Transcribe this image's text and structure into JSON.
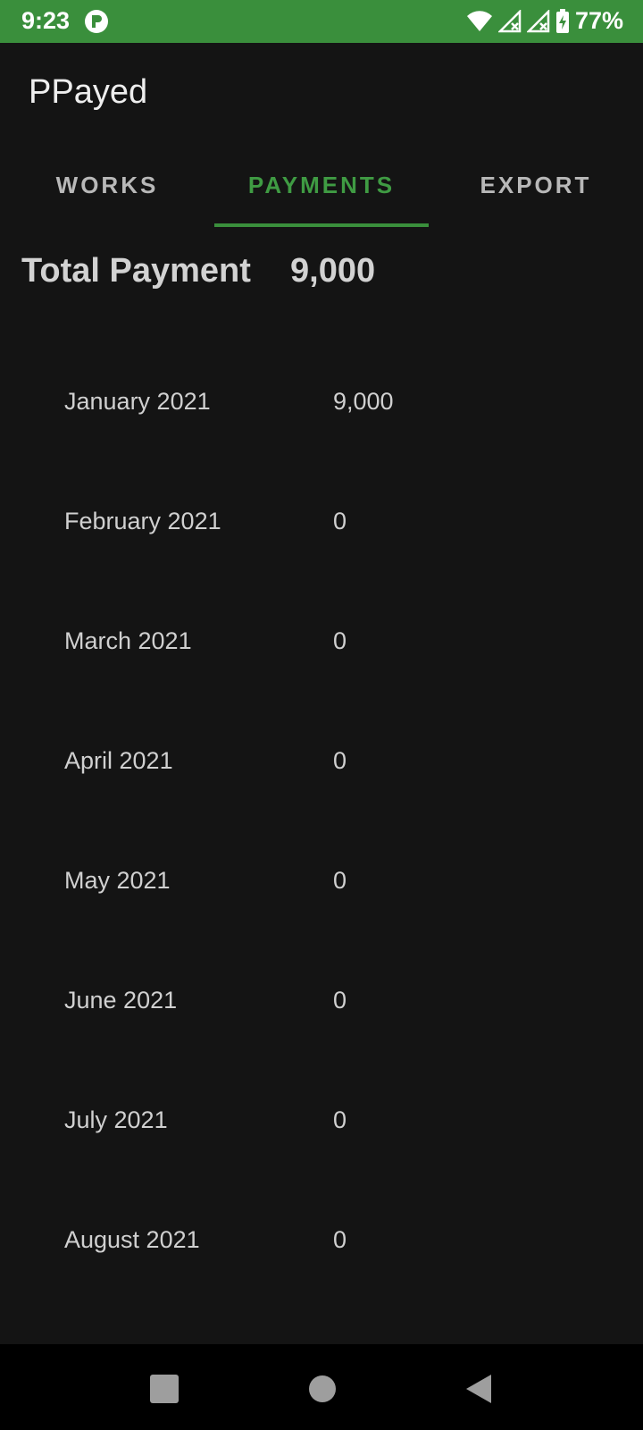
{
  "status_bar": {
    "time": "9:23",
    "battery": "77%",
    "icons": [
      "app-notification-icon",
      "wifi-icon",
      "signal-no-service-icon",
      "signal-no-service-icon",
      "battery-charging-icon"
    ]
  },
  "app": {
    "title": "PPayed"
  },
  "tabs": [
    {
      "label": "WORKS"
    },
    {
      "label": "PAYMENTS"
    },
    {
      "label": "EXPORT"
    }
  ],
  "total": {
    "label": "Total Payment",
    "value": "9,000"
  },
  "months": [
    {
      "name": "January 2021",
      "amount": "9,000"
    },
    {
      "name": "February 2021",
      "amount": "0"
    },
    {
      "name": "March 2021",
      "amount": "0"
    },
    {
      "name": "April 2021",
      "amount": "0"
    },
    {
      "name": "May 2021",
      "amount": "0"
    },
    {
      "name": "June 2021",
      "amount": "0"
    },
    {
      "name": "July 2021",
      "amount": "0"
    },
    {
      "name": "August 2021",
      "amount": "0"
    }
  ],
  "colors": {
    "accent": "#3a8f3c",
    "background": "#141414",
    "text": "#d0d0d0"
  }
}
